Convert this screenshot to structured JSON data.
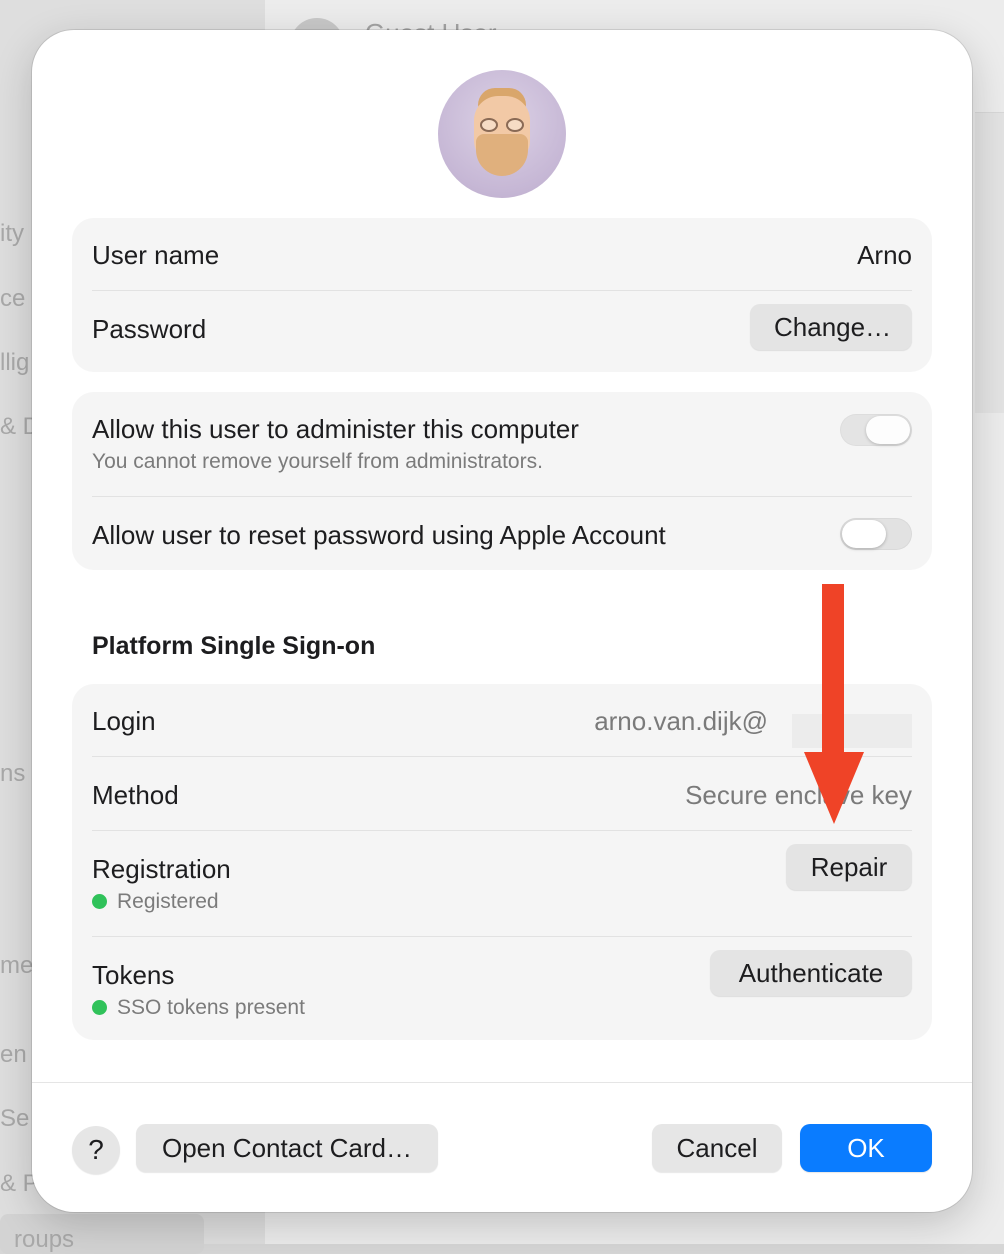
{
  "background": {
    "window_title": "Guest User",
    "sidebar_fragments": [
      "ity",
      "ce",
      "llig",
      "& De",
      "ns",
      "me",
      "en",
      "Se",
      "& Pa",
      "roups"
    ]
  },
  "dialog": {
    "user_name_label": "User name",
    "user_name_value": "Arno",
    "password_label": "Password",
    "change_button": "Change…",
    "admin_toggle_label": "Allow this user to administer this computer",
    "admin_toggle_note": "You cannot remove yourself from administrators.",
    "admin_toggle_on": false,
    "reset_toggle_label": "Allow user to reset password using Apple Account",
    "reset_toggle_on": false,
    "sso_section_title": "Platform Single Sign-on",
    "login_label": "Login",
    "login_value": "arno.van.dijk@",
    "method_label": "Method",
    "method_value": "Secure enclave key",
    "registration_label": "Registration",
    "registration_status": "Registered",
    "repair_button": "Repair",
    "tokens_label": "Tokens",
    "tokens_status": "SSO tokens present",
    "authenticate_button": "Authenticate",
    "status_color": "#30c25a"
  },
  "footer": {
    "help_button": "?",
    "open_contact_card_button": "Open Contact Card…",
    "cancel_button": "Cancel",
    "ok_button": "OK",
    "accent_color": "#0a7cff"
  },
  "annotation": {
    "arrow_color": "#ef4327",
    "arrow_direction": "down"
  }
}
